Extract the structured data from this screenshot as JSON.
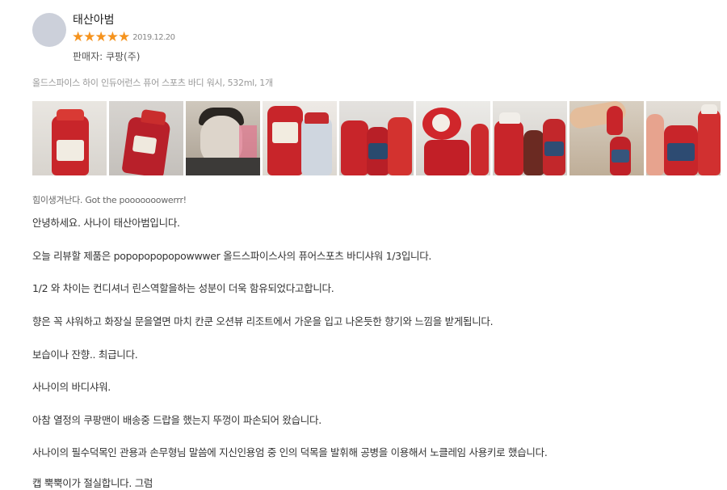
{
  "review": {
    "reviewer_name": "태산아범",
    "rating": 5,
    "rating_max": 5,
    "date": "2019.12.20",
    "seller": "판매자: 쿠팡(주)",
    "product_name": "올드스파이스 하이 인듀어런스 퓨어 스포츠 바디 워시, 532ml, 1개",
    "headline": "힘이생겨난다. Got the pooooooowerrr!",
    "photos": [
      {
        "name": "photo-1-bottle"
      },
      {
        "name": "photo-2-bottle-back"
      },
      {
        "name": "photo-3-face-mask"
      },
      {
        "name": "photo-4-two-bottles"
      },
      {
        "name": "photo-5-bottles-shelf"
      },
      {
        "name": "photo-6-open-cap"
      },
      {
        "name": "photo-7-bottles-shelf"
      },
      {
        "name": "photo-8-arm-bottle"
      },
      {
        "name": "photo-9-bathroom-shelf"
      }
    ],
    "paragraphs": [
      "안녕하세요. 사나이 태산아범입니다.",
      "오늘 리뷰할 제품은 popopopopopowwwer 올드스파이스사의 퓨어스포츠 바디샤워 1/3입니다.",
      "1/2 와 차이는 컨디셔너 린스역할을하는 성분이 더욱 함유되었다고합니다.",
      "향은 꼭 샤워하고 화장실 문을열면 마치 칸쿤 오션뷰 리조트에서 가운을 입고 나온듯한 향기와 느낌을 받게됩니다.",
      "보습이나 잔향.. 최급니다.",
      "사나이의 바디샤워.",
      "아참 열정의 쿠팡맨이 배송중 드랍을 했는지 뚜껑이 파손되어 왔습니다.",
      "사나이의 필수덕목인 관용과 손무형님 말씀에 지신인용엄 중 인의 덕목을 발휘해 공병을 이용해서 노클레임 사용키로 했습니다.",
      "캡 뿍뿍이가 절실합니다. 그럼"
    ]
  },
  "colors": {
    "star": "#f5931e",
    "bottle_red": "#c8252a",
    "avatar": "#ccd0da"
  }
}
